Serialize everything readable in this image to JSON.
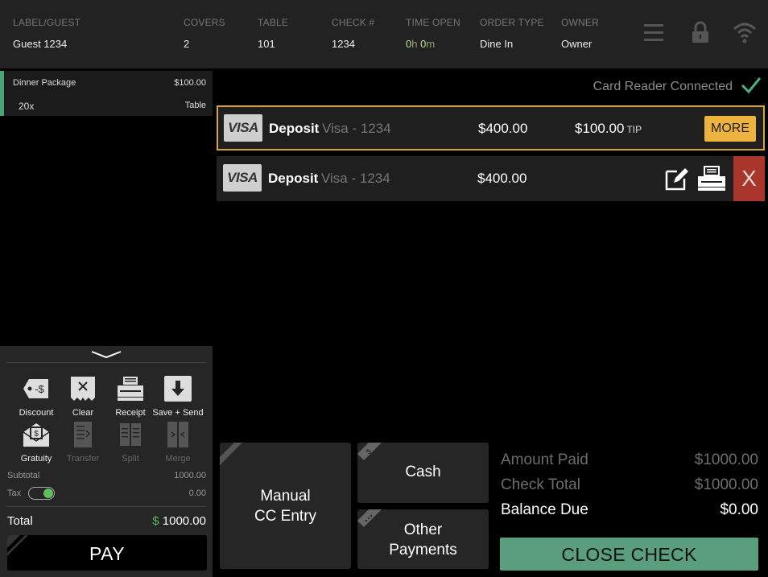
{
  "header": {
    "columns": [
      {
        "label": "LABEL/GUEST",
        "value": "Guest 1234"
      },
      {
        "label": "COVERS",
        "value": "2"
      },
      {
        "label": "TABLE",
        "value": "101"
      },
      {
        "label": "CHECK #",
        "value": "1234"
      },
      {
        "label": "TIME OPEN",
        "hours": "0",
        "h_unit": "h",
        "minutes": "0",
        "m_unit": "m"
      },
      {
        "label": "ORDER TYPE",
        "value": "Dine In"
      },
      {
        "label": "OWNER",
        "value": "Owner"
      }
    ],
    "icons": [
      "menu-icon",
      "lock-icon",
      "wifi-icon"
    ]
  },
  "order": {
    "items": [
      {
        "name": "Dinner Package",
        "price": "$100.00",
        "qty": "20x",
        "modifier": "Table"
      }
    ]
  },
  "tools": {
    "row1": [
      {
        "label": "Discount",
        "icon": "discount-tag-icon"
      },
      {
        "label": "Clear",
        "icon": "clear-receipt-icon"
      },
      {
        "label": "Receipt",
        "icon": "printer-icon"
      },
      {
        "label": "Save + Send",
        "icon": "download-icon"
      }
    ],
    "row2": [
      {
        "label": "Gratuity",
        "icon": "gratuity-envelope-icon"
      },
      {
        "label": "Transfer",
        "icon": "transfer-icon"
      },
      {
        "label": "Split",
        "icon": "split-icon"
      },
      {
        "label": "Merge",
        "icon": "merge-icon"
      }
    ]
  },
  "summary": {
    "subtotal_label": "Subtotal",
    "subtotal_value": "1000.00",
    "tax_label": "Tax",
    "tax_value": "0.00",
    "tax_enabled": true,
    "total_label": "Total",
    "total_currency": "$",
    "total_value": "1000.00"
  },
  "pay_button": {
    "label": "PAY"
  },
  "card_reader": {
    "status": "Card Reader Connected"
  },
  "payments": [
    {
      "brand": "VISA",
      "type": "Deposit",
      "card": "Visa - 1234",
      "amount": "$400.00",
      "tip": "$100.00",
      "tip_label": "TIP",
      "action": "MORE"
    },
    {
      "brand": "VISA",
      "type": "Deposit",
      "card": "Visa - 1234",
      "amount": "$400.00",
      "delete_label": "X"
    }
  ],
  "payment_buttons": {
    "manual_line1": "Manual",
    "manual_line2": "CC Entry",
    "cash": "Cash",
    "other_line1": "Other",
    "other_line2": "Payments"
  },
  "totals": {
    "amount_paid_label": "Amount Paid",
    "amount_paid_value": "$1000.00",
    "check_total_label": "Check Total",
    "check_total_value": "$1000.00",
    "balance_due_label": "Balance Due",
    "balance_due_value": "$0.00"
  },
  "close_button": {
    "label": "CLOSE CHECK"
  },
  "colors": {
    "accent_green": "#5a9e7d",
    "more_orange": "#eeb23f",
    "delete_red": "#a9352b",
    "selected_border": "#d6a43a"
  }
}
